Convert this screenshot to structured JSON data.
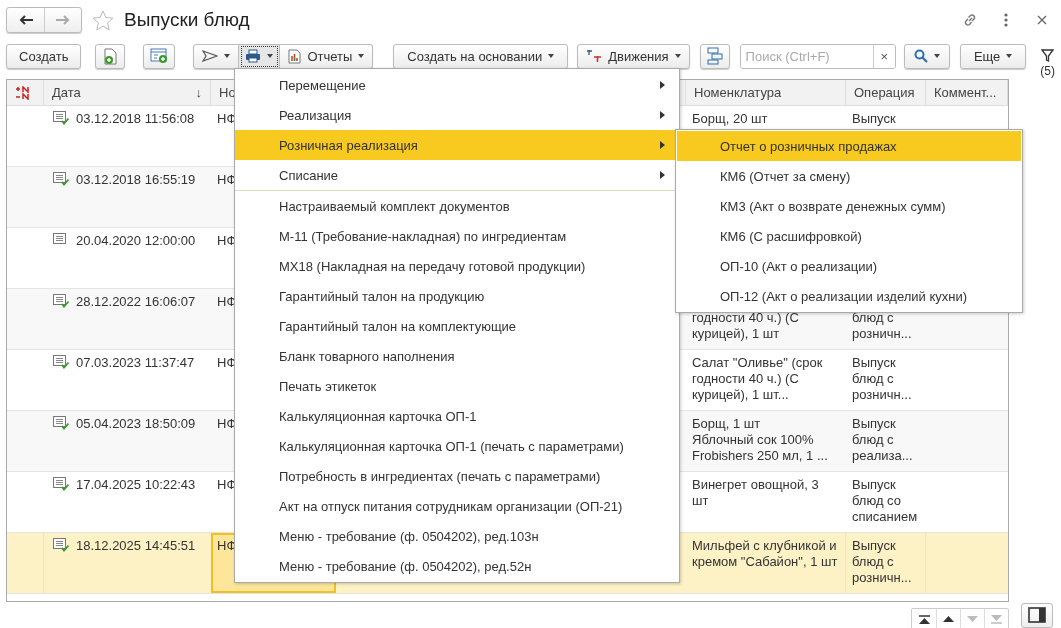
{
  "window": {
    "title": "Выпуски блюд"
  },
  "toolbar": {
    "create": "Создать",
    "reports": "Отчеты",
    "create_based": "Создать на основании",
    "movements": "Движения",
    "search": {
      "placeholder": "Поиск (Ctrl+F)",
      "clear": "×"
    },
    "more": "Еще",
    "filter_count": "(5)"
  },
  "table": {
    "columns": [
      {
        "label": "Дата",
        "sort_mark": "↓"
      },
      {
        "label": "Но"
      },
      {},
      {},
      {
        "label": "Номенклатура"
      },
      {
        "label": "Операция"
      },
      {
        "label": "Коммент..."
      }
    ],
    "rows": [
      {
        "posted": true,
        "date": "03.12.2018 11:56:08",
        "number": "НФ",
        "nomenclature": "Борщ, 20 шт",
        "operation": "Выпуск",
        "continued": false,
        "selected": false
      },
      {
        "posted": true,
        "date": "03.12.2018 16:55:19",
        "number": "НФ",
        "selected": false
      },
      {
        "posted": false,
        "date": "20.04.2020 12:00:00",
        "number": "НФ",
        "selected": false
      },
      {
        "posted": true,
        "date": "28.12.2022 16:06:07",
        "number": "НФ",
        "nomenclature": "годности 40 ч.) (С курицей), 1 шт",
        "operation": "блюд с розничн...",
        "continued": true,
        "selected": false
      },
      {
        "posted": true,
        "date": "07.03.2023 11:37:47",
        "number": "НФ",
        "nomenclature": "Салат \"Оливье\" (срок годности 40 ч.) (С курицей), 1 шт...",
        "operation": "Выпуск блюд с розничн...",
        "continued": false,
        "selected": false
      },
      {
        "posted": true,
        "date": "05.04.2023 18:50:09",
        "number": "НФ",
        "nomenclature": "Борщ, 1 шт\nЯблочный сок 100% Frobishers 250 мл, 1 ...",
        "operation": "Выпуск блюд с реализа...",
        "continued": false,
        "selected": false
      },
      {
        "posted": true,
        "date": "17.04.2025 10:22:43",
        "number": "НФ",
        "nomenclature": "Винегрет овощной, 3\nшт",
        "operation": "Выпуск блюд со списанием",
        "continued": false,
        "selected": false
      },
      {
        "posted": true,
        "date": "18.12.2025 14:45:51",
        "number": "НФ",
        "nomenclature": "Мильфей с клубникой и кремом \"Сабайон\", 1 шт",
        "operation": "Выпуск блюд с розничн...",
        "continued": false,
        "selected": true
      }
    ]
  },
  "print_menu": {
    "groups": [
      [
        {
          "label": "Перемещение",
          "has_submenu": true,
          "selected": false
        },
        {
          "label": "Реализация",
          "has_submenu": true,
          "selected": false
        },
        {
          "label": "Розничная реализация",
          "has_submenu": true,
          "selected": true
        },
        {
          "label": "Списание",
          "has_submenu": true,
          "selected": false
        }
      ],
      [
        {
          "label": "Настраиваемый комплект документов",
          "has_submenu": false,
          "selected": false
        },
        {
          "label": "М-11 (Требование-накладная) по ингредиентам",
          "has_submenu": false,
          "selected": false
        },
        {
          "label": "МХ18 (Накладная на передачу готовой продукции)",
          "has_submenu": false,
          "selected": false
        },
        {
          "label": "Гарантийный талон на продукцию",
          "has_submenu": false,
          "selected": false
        },
        {
          "label": "Гарантийный талон на комплектующие",
          "has_submenu": false,
          "selected": false
        },
        {
          "label": "Бланк товарного наполнения",
          "has_submenu": false,
          "selected": false
        },
        {
          "label": "Печать этикеток",
          "has_submenu": false,
          "selected": false
        },
        {
          "label": "Калькуляционная карточка ОП-1",
          "has_submenu": false,
          "selected": false
        },
        {
          "label": "Калькуляционная карточка ОП-1 (печать с параметрами)",
          "has_submenu": false,
          "selected": false
        },
        {
          "label": "Потребность в ингредиентах (печать с параметрами)",
          "has_submenu": false,
          "selected": false
        },
        {
          "label": "Акт на отпуск питания сотрудникам организации (ОП-21)",
          "has_submenu": false,
          "selected": false
        },
        {
          "label": "Меню - требование (ф. 0504202), ред.103н",
          "has_submenu": false,
          "selected": false
        },
        {
          "label": "Меню - требование (ф. 0504202), ред.52н",
          "has_submenu": false,
          "selected": false
        }
      ]
    ]
  },
  "submenu": {
    "items": [
      {
        "label": "Отчет о розничных продажах",
        "selected": true
      },
      {
        "label": "КМ6 (Отчет за смену)",
        "selected": false
      },
      {
        "label": "КМ3 (Акт о возврате денежных сумм)",
        "selected": false
      },
      {
        "label": "КМ6 (С расшифровкой)",
        "selected": false
      },
      {
        "label": "ОП-10 (Акт о реализации)",
        "selected": false
      },
      {
        "label": "ОП-12 (Акт о реализации изделий кухни)",
        "selected": false
      }
    ]
  },
  "navigation": [
    {
      "kind": "first",
      "disabled": false
    },
    {
      "kind": "prev",
      "disabled": false
    },
    {
      "kind": "next",
      "disabled": true
    },
    {
      "kind": "last",
      "disabled": true
    }
  ]
}
